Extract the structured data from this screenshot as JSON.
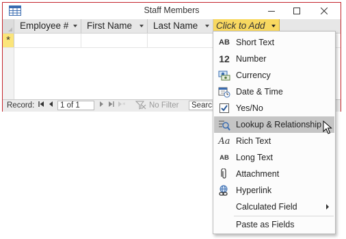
{
  "window": {
    "title": "Staff Members",
    "controls": {
      "minimize": "minimize",
      "maximize": "maximize",
      "close": "close"
    }
  },
  "table": {
    "columns": [
      {
        "label": "Employee #"
      },
      {
        "label": "First Name"
      },
      {
        "label": "Last Name"
      },
      {
        "label": "Click to Add"
      }
    ],
    "new_row_marker": "*"
  },
  "navbar": {
    "record_label": "Record:",
    "position": "1 of 1",
    "filter_label": "No Filter",
    "search_label": "Search"
  },
  "menu": {
    "items": [
      {
        "icon": "AB",
        "label": "Short Text"
      },
      {
        "icon": "12",
        "label": "Number"
      },
      {
        "icon": "currency-icon",
        "label": "Currency"
      },
      {
        "icon": "calendar-icon",
        "label": "Date & Time"
      },
      {
        "icon": "checkbox-icon",
        "label": "Yes/No"
      },
      {
        "icon": "lookup-icon",
        "label": "Lookup & Relationship",
        "highlighted": true
      },
      {
        "icon": "Aa",
        "label": "Rich Text"
      },
      {
        "icon": "AB",
        "label": "Long Text"
      },
      {
        "icon": "paperclip-icon",
        "label": "Attachment"
      },
      {
        "icon": "hyperlink-icon",
        "label": "Hyperlink"
      },
      {
        "icon": "",
        "label": "Calculated Field",
        "submenu": true
      },
      {
        "icon": "",
        "label": "Paste as Fields"
      }
    ]
  },
  "colors": {
    "window_border": "#c4242b",
    "click_to_add_bg": "#f8d860",
    "new_row_selector": "#fbe57a",
    "menu_highlight": "#c5c5c5"
  }
}
